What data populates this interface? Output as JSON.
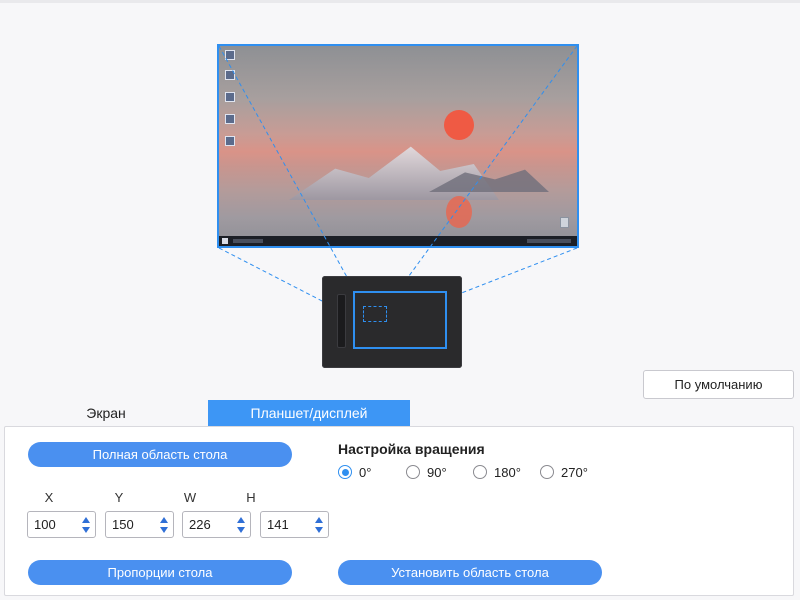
{
  "default_button": "По умолчанию",
  "tabs": [
    {
      "label": "Экран",
      "active": false
    },
    {
      "label": "Планшет/дисплей",
      "active": true
    }
  ],
  "buttons": {
    "full_area": "Полная область стола",
    "proportion": "Пропорции стола",
    "set_area": "Установить область стола"
  },
  "rotation": {
    "title": "Настройка вращения",
    "options": [
      "0°",
      "90°",
      "180°",
      "270°"
    ],
    "selected": "0°"
  },
  "fields": [
    {
      "label": "X",
      "value": "100"
    },
    {
      "label": "Y",
      "value": "150"
    },
    {
      "label": "W",
      "value": "226"
    },
    {
      "label": "H",
      "value": "141"
    }
  ],
  "colors": {
    "accent": "#2f8ff0",
    "tab_active": "#3d96f5",
    "pill_button": "#4a90f0",
    "tablet_body": "#2a2a2c"
  }
}
